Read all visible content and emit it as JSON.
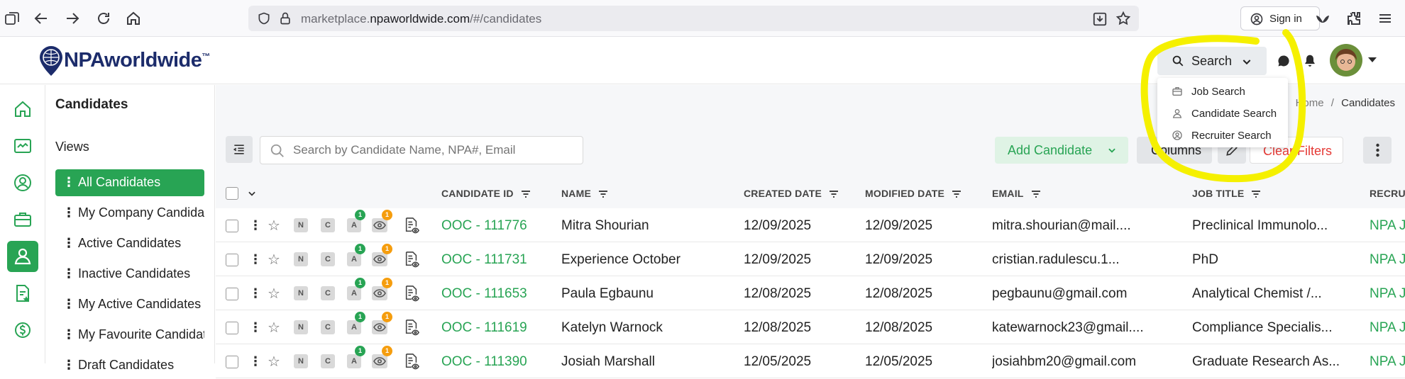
{
  "browser": {
    "url_prefix": "marketplace.",
    "url_host": "npaworldwide.com",
    "url_path": "/#/candidates",
    "signin_label": "Sign in"
  },
  "header": {
    "logo_text": "NPAworldwide",
    "logo_tm": "™",
    "search_label": "Search"
  },
  "search_menu": {
    "items": [
      {
        "label": "Job Search",
        "icon": "briefcase-icon"
      },
      {
        "label": "Candidate Search",
        "icon": "person-icon"
      },
      {
        "label": "Recruiter Search",
        "icon": "person-circle-icon"
      }
    ]
  },
  "sidebar": {
    "title": "Candidates",
    "views_label": "Views",
    "views": [
      {
        "label": "All Candidates"
      },
      {
        "label": "My Company Candidates"
      },
      {
        "label": "Active Candidates"
      },
      {
        "label": "Inactive Candidates"
      },
      {
        "label": "My Active Candidates"
      },
      {
        "label": "My Favourite Candidates"
      },
      {
        "label": "Draft Candidates"
      }
    ]
  },
  "breadcrumb": {
    "home": "Home",
    "sep": "/",
    "current": "Candidates"
  },
  "toolbar": {
    "search_placeholder": "Search by Candidate Name, NPA#, Email",
    "add_candidate_label": "Add Candidate",
    "columns_label": "Columns",
    "clear_filters_label": "Clear Filters"
  },
  "table": {
    "columns": [
      "CANDIDATE ID",
      "NAME",
      "CREATED DATE",
      "MODIFIED DATE",
      "EMAIL",
      "JOB TITLE",
      "RECRU"
    ],
    "badges": {
      "n": "N",
      "c": "C",
      "a": "A"
    },
    "rows": [
      {
        "id": "OOC - 111776",
        "name": "Mitra Shourian",
        "created": "12/09/2025",
        "modified": "12/09/2025",
        "email": "mitra.shourian@mail....",
        "job_title": "Preclinical Immunolo...",
        "recruiter": "NPA J",
        "a_count": "1",
        "eye_count": "1"
      },
      {
        "id": "OOC - 111731",
        "name": "Experience October",
        "created": "12/09/2025",
        "modified": "12/09/2025",
        "email": "cristian.radulescu.1...",
        "job_title": "PhD",
        "recruiter": "NPA J",
        "a_count": "1",
        "eye_count": "1"
      },
      {
        "id": "OOC - 111653",
        "name": "Paula Egbaunu",
        "created": "12/08/2025",
        "modified": "12/08/2025",
        "email": "pegbaunu@gmail.com",
        "job_title": "Analytical Chemist /...",
        "recruiter": "NPA J",
        "a_count": "1",
        "eye_count": "1"
      },
      {
        "id": "OOC - 111619",
        "name": "Katelyn Warnock",
        "created": "12/08/2025",
        "modified": "12/08/2025",
        "email": "katewarnock23@gmail....",
        "job_title": "Compliance Specialis...",
        "recruiter": "NPA J",
        "a_count": "1",
        "eye_count": "1"
      },
      {
        "id": "OOC - 111390",
        "name": "Josiah Marshall",
        "created": "12/05/2025",
        "modified": "12/05/2025",
        "email": "josiahbm20@gmail.com",
        "job_title": "Graduate Research As...",
        "recruiter": "NPA J",
        "a_count": "1",
        "eye_count": "1"
      }
    ]
  },
  "colors": {
    "brand_green": "#28a454",
    "annotation_yellow": "#f5f000",
    "danger": "#e53935"
  }
}
